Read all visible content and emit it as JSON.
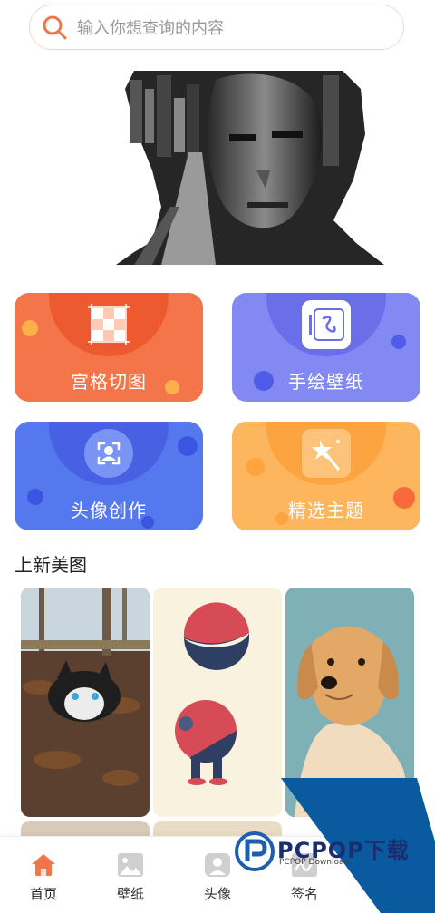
{
  "search": {
    "placeholder": "输入你想查询的内容",
    "icon": "search-icon"
  },
  "categories": [
    {
      "label": "宫格切图",
      "icon": "grid-icon",
      "color": "#f5754a"
    },
    {
      "label": "手绘壁纸",
      "icon": "handdraw-icon",
      "color": "#8389f2"
    },
    {
      "label": "头像创作",
      "icon": "avatar-frame-icon",
      "color": "#5678ef"
    },
    {
      "label": "精选主题",
      "icon": "magic-wand-icon",
      "color": "#fdb55e"
    }
  ],
  "section": {
    "title": "上新美图"
  },
  "watermark": {
    "title": "PCPOP下载",
    "subtitle": "PCPOP Download"
  },
  "tabs": [
    {
      "label": "首页",
      "icon": "home-icon",
      "active": true
    },
    {
      "label": "壁纸",
      "icon": "image-icon",
      "active": false
    },
    {
      "label": "头像",
      "icon": "portrait-icon",
      "active": false
    },
    {
      "label": "签名",
      "icon": "signature-icon",
      "active": false
    }
  ]
}
